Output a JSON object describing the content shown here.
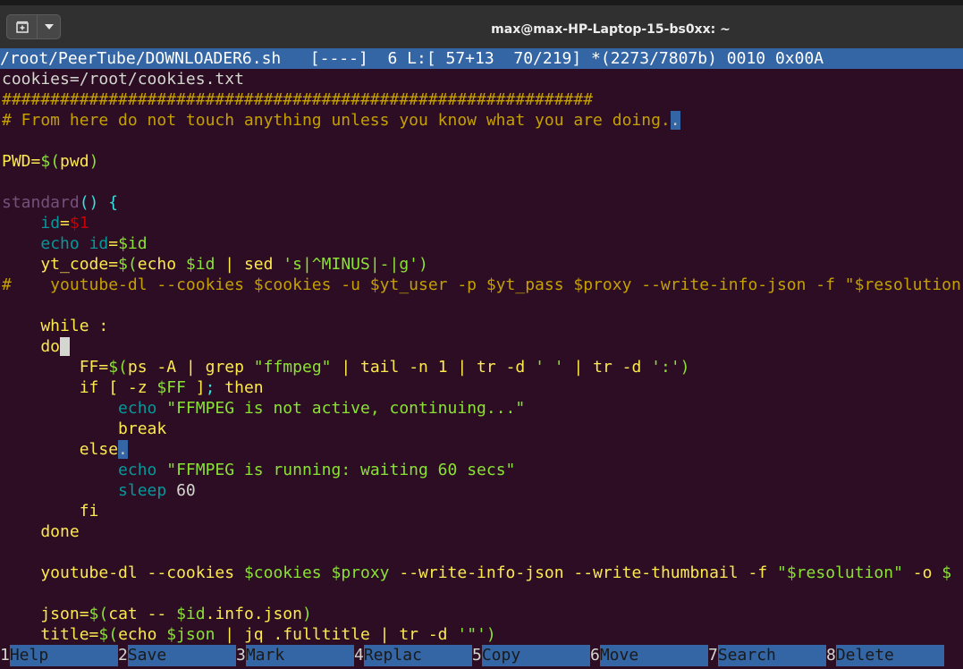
{
  "window": {
    "title": "max@max-HP-Laptop-15-bs0xx: ~",
    "icons": {
      "new_tab": "new-tab-icon",
      "menu": "chevron-down-icon"
    }
  },
  "editor": {
    "status_line": "/root/PeerTube/DOWNLOADER6.sh   [----]  6 L:[ 57+13  70/219] *(2273/7807b) 0010 0x00A",
    "lines": [
      [
        [
          "cookies=/root/cookies.txt",
          0
        ]
      ],
      [
        [
          "#############################################################",
          5
        ]
      ],
      [
        [
          "# From here do not touch anything unless you know what you are doing.",
          5
        ],
        [
          ".",
          7
        ]
      ],
      [
        [
          "",
          0
        ]
      ],
      [
        [
          "PWD=",
          1
        ],
        [
          "$(",
          2
        ],
        [
          "pwd",
          1
        ],
        [
          ")",
          2
        ]
      ],
      [
        [
          "",
          0
        ]
      ],
      [
        [
          "standard",
          9
        ],
        [
          "() {",
          6
        ]
      ],
      [
        [
          "    ",
          0
        ],
        [
          "id",
          3
        ],
        [
          "=",
          1
        ],
        [
          "$1",
          4
        ]
      ],
      [
        [
          "    ",
          0
        ],
        [
          "echo",
          3
        ],
        [
          " ",
          0
        ],
        [
          "id",
          3
        ],
        [
          "=",
          1
        ],
        [
          "$id",
          2
        ]
      ],
      [
        [
          "    yt_code=",
          1
        ],
        [
          "$(",
          2
        ],
        [
          "echo ",
          1
        ],
        [
          "$id",
          2
        ],
        [
          " | sed ",
          1
        ],
        [
          "'s|^MINUS|-|g'",
          2
        ],
        [
          ")",
          2
        ]
      ],
      [
        [
          "#    youtube-dl --cookies $cookies -u $yt_user -p $yt_pass $proxy --write-info-json -f \"$resolution\" -o $",
          5
        ]
      ],
      [
        [
          "",
          0
        ]
      ],
      [
        [
          "    while :",
          1
        ]
      ],
      [
        [
          "    do",
          1
        ],
        [
          " ",
          8
        ]
      ],
      [
        [
          "        FF=",
          1
        ],
        [
          "$(",
          2
        ],
        [
          "ps -A | grep ",
          1
        ],
        [
          "\"ffmpeg\"",
          2
        ],
        [
          " | tail -n 1 | tr -d ",
          1
        ],
        [
          "' '",
          2
        ],
        [
          " | tr -d ",
          1
        ],
        [
          "':'",
          2
        ],
        [
          ")",
          2
        ]
      ],
      [
        [
          "        if [ -z ",
          1
        ],
        [
          "$FF",
          2
        ],
        [
          " ]",
          1
        ],
        [
          "; ",
          6
        ],
        [
          "then",
          1
        ]
      ],
      [
        [
          "            ",
          0
        ],
        [
          "echo",
          3
        ],
        [
          " ",
          0
        ],
        [
          "\"FFMPEG is not active, continuing...\"",
          2
        ]
      ],
      [
        [
          "            break",
          1
        ]
      ],
      [
        [
          "        else",
          1
        ],
        [
          ".",
          7
        ]
      ],
      [
        [
          "            ",
          0
        ],
        [
          "echo",
          3
        ],
        [
          " ",
          0
        ],
        [
          "\"FFMPEG is running: waiting 60 secs\"",
          2
        ]
      ],
      [
        [
          "            ",
          0
        ],
        [
          "sleep",
          3
        ],
        [
          " 60",
          0
        ]
      ],
      [
        [
          "        fi",
          1
        ]
      ],
      [
        [
          "    done",
          1
        ]
      ],
      [
        [
          "",
          0
        ]
      ],
      [
        [
          "    youtube-dl --cookies ",
          1
        ],
        [
          "$cookies",
          2
        ],
        [
          " ",
          1
        ],
        [
          "$proxy",
          2
        ],
        [
          " --write-info-json --write-thumbnail -f ",
          1
        ],
        [
          "\"",
          2
        ],
        [
          "$resolution",
          2
        ],
        [
          "\"",
          2
        ],
        [
          " -o ",
          1
        ],
        [
          "$",
          2
        ]
      ],
      [
        [
          "",
          0
        ]
      ],
      [
        [
          "    json=",
          1
        ],
        [
          "$(",
          2
        ],
        [
          "cat -- ",
          1
        ],
        [
          "$id",
          2
        ],
        [
          ".info.json",
          1
        ],
        [
          ")",
          2
        ]
      ],
      [
        [
          "    title=",
          1
        ],
        [
          "$(",
          2
        ],
        [
          "echo ",
          1
        ],
        [
          "$json",
          2
        ],
        [
          " | jq .fulltitle | tr -d ",
          1
        ],
        [
          "'\"'",
          2
        ],
        [
          ")",
          2
        ]
      ]
    ]
  },
  "function_keys": [
    {
      "num": "1",
      "label": "Help"
    },
    {
      "num": "2",
      "label": "Save"
    },
    {
      "num": "3",
      "label": "Mark"
    },
    {
      "num": "4",
      "label": "Replac"
    },
    {
      "num": "5",
      "label": "Copy"
    },
    {
      "num": "6",
      "label": "Move"
    },
    {
      "num": "7",
      "label": "Search"
    },
    {
      "num": "8",
      "label": "Delete"
    }
  ]
}
